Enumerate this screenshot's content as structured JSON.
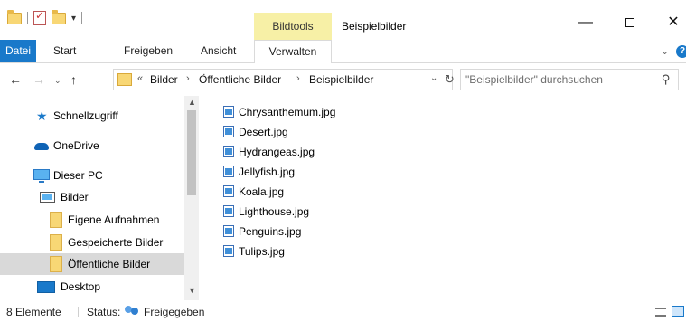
{
  "window": {
    "title": "Beispielbilder",
    "context_tab_group": "Bildtools",
    "controls": {
      "minimize": "—",
      "maximize": "",
      "close": "✕"
    }
  },
  "ribbon": {
    "tabs": [
      {
        "label": "Datei",
        "active": true
      },
      {
        "label": "Start"
      },
      {
        "label": "Freigeben"
      },
      {
        "label": "Ansicht"
      },
      {
        "label": "Verwalten"
      }
    ],
    "expand_glyph": "⌄",
    "help_glyph": "?"
  },
  "navigation": {
    "back": "←",
    "forward": "→",
    "recent": "⌄",
    "up": "↑"
  },
  "address": {
    "overflow": "«",
    "crumbs": [
      "Bilder",
      "Öffentliche Bilder",
      "Beispielbilder"
    ],
    "separator": "›",
    "dropdown": "⌄",
    "refresh": "↻"
  },
  "search": {
    "placeholder": "\"Beispielbilder\" durchsuchen",
    "icon": "⚲"
  },
  "nav_pane": {
    "items": [
      {
        "label": "Schnellzugriff",
        "icon": "star-icon"
      },
      {
        "label": "OneDrive",
        "icon": "onedrive-icon"
      },
      {
        "label": "Dieser PC",
        "icon": "pc-icon"
      },
      {
        "label": "Bilder",
        "icon": "pictures-icon"
      },
      {
        "label": "Eigene Aufnahmen",
        "icon": "folder-icon"
      },
      {
        "label": "Gespeicherte Bilder",
        "icon": "folder-icon"
      },
      {
        "label": "Öffentliche Bilder",
        "icon": "folder-icon",
        "selected": true
      },
      {
        "label": "Desktop",
        "icon": "desktop-icon"
      }
    ]
  },
  "files": [
    "Chrysanthemum.jpg",
    "Desert.jpg",
    "Hydrangeas.jpg",
    "Jellyfish.jpg",
    "Koala.jpg",
    "Lighthouse.jpg",
    "Penguins.jpg",
    "Tulips.jpg"
  ],
  "status": {
    "count": "8 Elemente",
    "status_label": "Status:",
    "shared": "Freigegeben"
  },
  "colors": {
    "accent": "#1979ca",
    "context_tab": "#f7f0a6",
    "selected_row": "#d9d9d9"
  }
}
